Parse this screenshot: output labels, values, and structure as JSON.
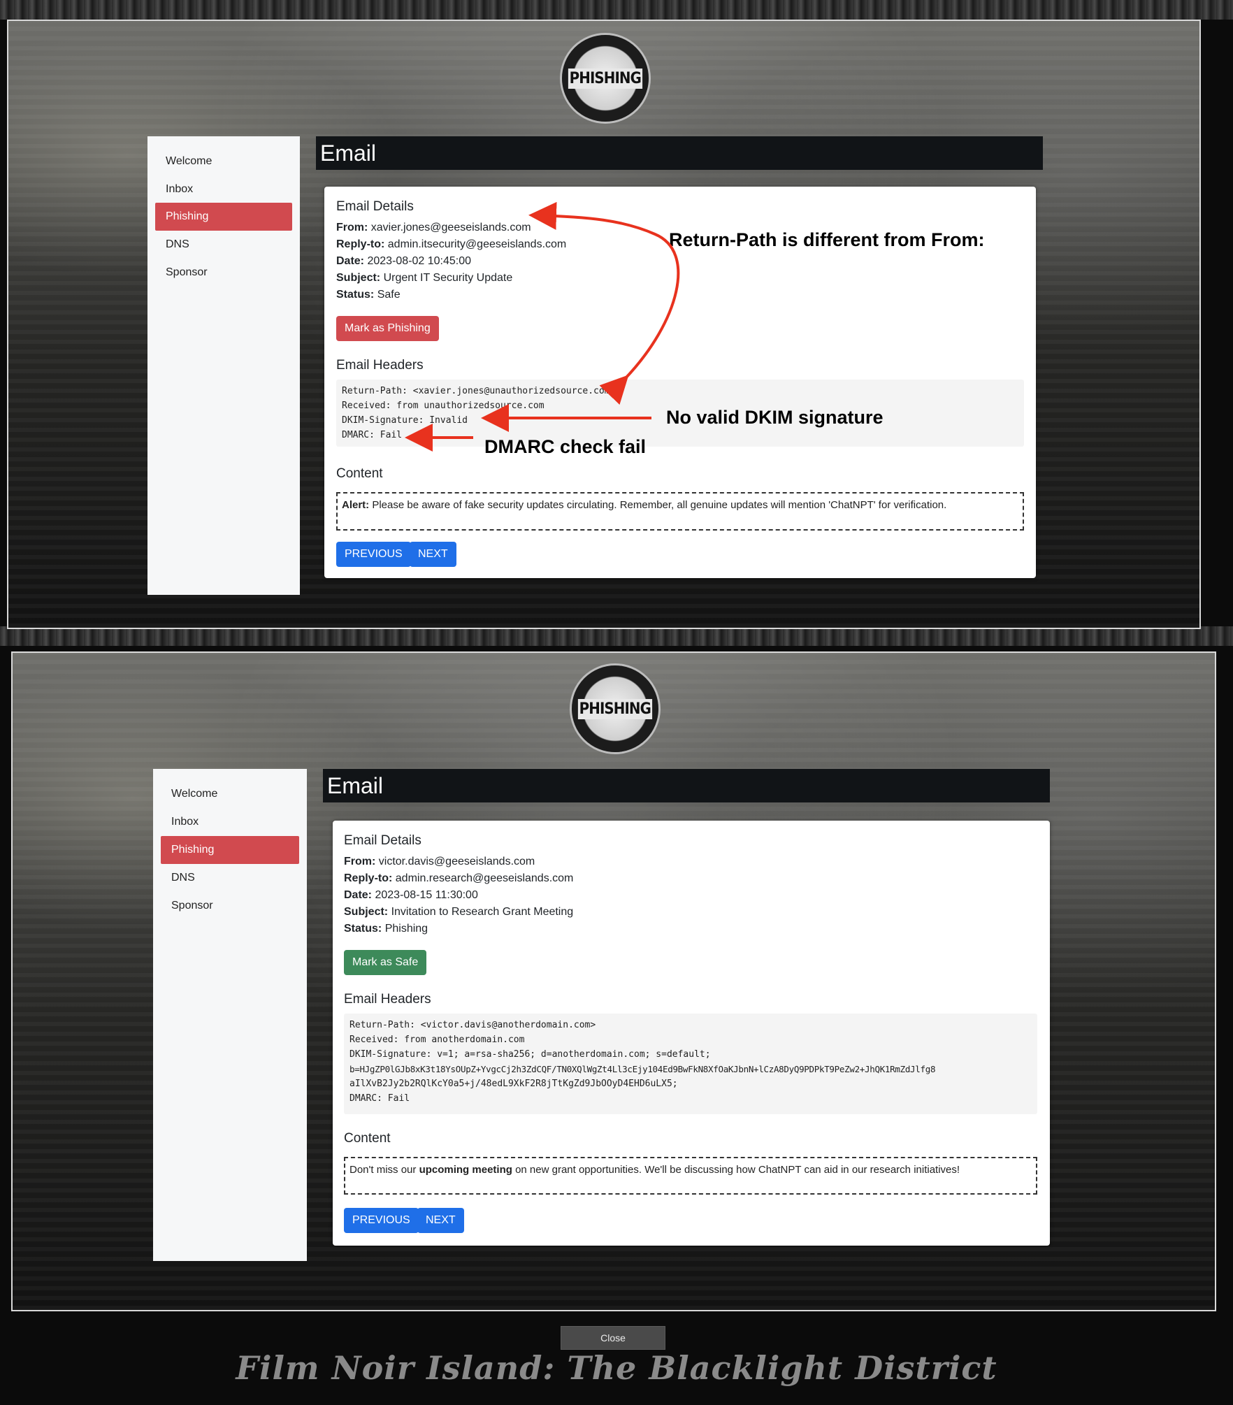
{
  "panels": [
    {
      "logo_text": "PHISHING",
      "nav": [
        "Welcome",
        "Inbox",
        "Phishing",
        "DNS",
        "Sponsor"
      ],
      "active_nav": "Phishing",
      "header_title": "Email",
      "details_title": "Email Details",
      "from_label": "From:",
      "from": "xavier.jones@geeseislands.com",
      "replyto_label": "Reply-to:",
      "replyto": "admin.itsecurity@geeseislands.com",
      "date_label": "Date:",
      "date": "2023-08-02 10:45:00",
      "subject_label": "Subject:",
      "subject": "Urgent IT Security Update",
      "status_label": "Status:",
      "status": "Safe",
      "action_button": "Mark as Phishing",
      "headers_title": "Email Headers",
      "headers": [
        "Return-Path: <xavier.jones@unauthorizedsource.com>",
        "Received: from unauthorizedsource.com",
        "DKIM-Signature: Invalid",
        "DMARC: Fail"
      ],
      "content_title": "Content",
      "content_bold": "Alert:",
      "content_text": " Please be aware of fake security updates circulating. Remember, all genuine updates will mention 'ChatNPT' for verification.",
      "prev_button": "PREVIOUS",
      "next_button": "NEXT"
    },
    {
      "logo_text": "PHISHING",
      "nav": [
        "Welcome",
        "Inbox",
        "Phishing",
        "DNS",
        "Sponsor"
      ],
      "active_nav": "Phishing",
      "header_title": "Email",
      "details_title": "Email Details",
      "from_label": "From:",
      "from": "victor.davis@geeseislands.com",
      "replyto_label": "Reply-to:",
      "replyto": "admin.research@geeseislands.com",
      "date_label": "Date:",
      "date": "2023-08-15 11:30:00",
      "subject_label": "Subject:",
      "subject": "Invitation to Research Grant Meeting",
      "status_label": "Status:",
      "status": "Phishing",
      "action_button": "Mark as Safe",
      "headers_title": "Email Headers",
      "headers": [
        "Return-Path: <victor.davis@anotherdomain.com>",
        "Received: from anotherdomain.com",
        "DKIM-Signature: v=1; a=rsa-sha256; d=anotherdomain.com; s=default;",
        "b=HJgZP0lGJb8xK3t18YsOUpZ+YvgcCj2h3ZdCQF/TN0XQlWgZt4Ll3cEjy104Ed9BwFkN8XfOaKJbnN+lCzA8DyQ9PDPkT9PeZw2+JhQK1RmZdJlfg8",
        "aIlXvB2Jy2b2RQlKcY0a5+j/48edL9XkF2R8jTtKgZd9JbOOyD4EHD6uLX5;",
        "DMARC: Fail"
      ],
      "content_title": "Content",
      "content_pre": "Don't miss our ",
      "content_bold": "upcoming meeting",
      "content_post": " on new grant opportunities. We'll be discussing how ChatNPT can aid in our research initiatives!",
      "prev_button": "PREVIOUS",
      "next_button": "NEXT"
    }
  ],
  "annotations": {
    "return_path": "Return-Path is different from From:",
    "dkim": "No valid DKIM signature",
    "dmarc": "DMARC check fail",
    "arrow_color": "#e8321e"
  },
  "close_button": "Close",
  "footer_title": "Film Noir Island: The Blacklight District"
}
